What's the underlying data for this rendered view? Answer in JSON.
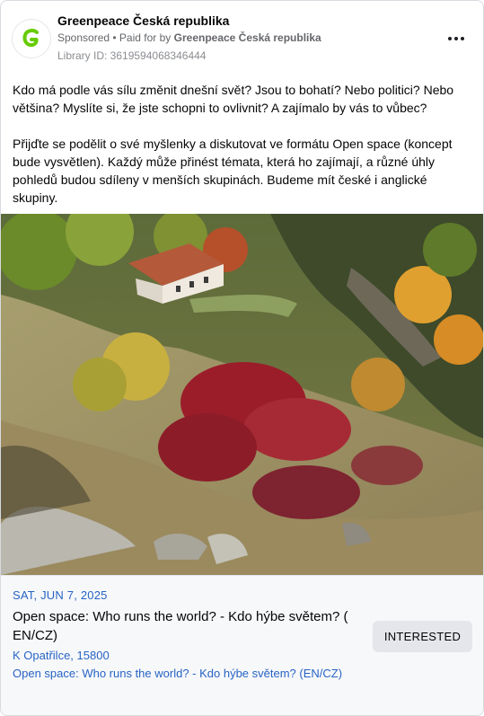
{
  "header": {
    "page_name": "Greenpeace Česká republika",
    "sponsored_label": "Sponsored",
    "paid_for_prefix": "• Paid for by",
    "paid_for_by": "Greenpeace Česká republika",
    "library_id": "Library ID: 3619594068346444",
    "avatar_letter": "G",
    "avatar_color": "#66cc00"
  },
  "body": {
    "paragraph_1": "Kdo má podle vás sílu změnit dnešní svět? Jsou to bohatí? Nebo politici? Nebo většina? Myslíte si, že jste schopni to ovlivnit? A zajímalo by vás to vůbec?",
    "paragraph_2": "Přijďte se podělit o své myšlenky a diskutovat ve formátu Open space (koncept bude vysvětlen). Každý může přinést témata, která ho zajímají, a různé úhly pohledů budou sdíleny v menších skupinách. Budeme mít české i anglické skupiny.",
    "ellipsis": "..."
  },
  "event": {
    "date": "SAT, JUN 7, 2025",
    "title": "Open space: Who runs the world? - Kdo hýbe světem? ( EN/CZ)",
    "location": "K Opatřilce, 15800",
    "link_text": "Open space: Who runs the world? - Kdo hýbe světem? (EN/CZ)",
    "interested_label": "INTERESTED"
  },
  "colors": {
    "link_blue": "#2764c4",
    "button_gray": "#e4e6eb"
  }
}
